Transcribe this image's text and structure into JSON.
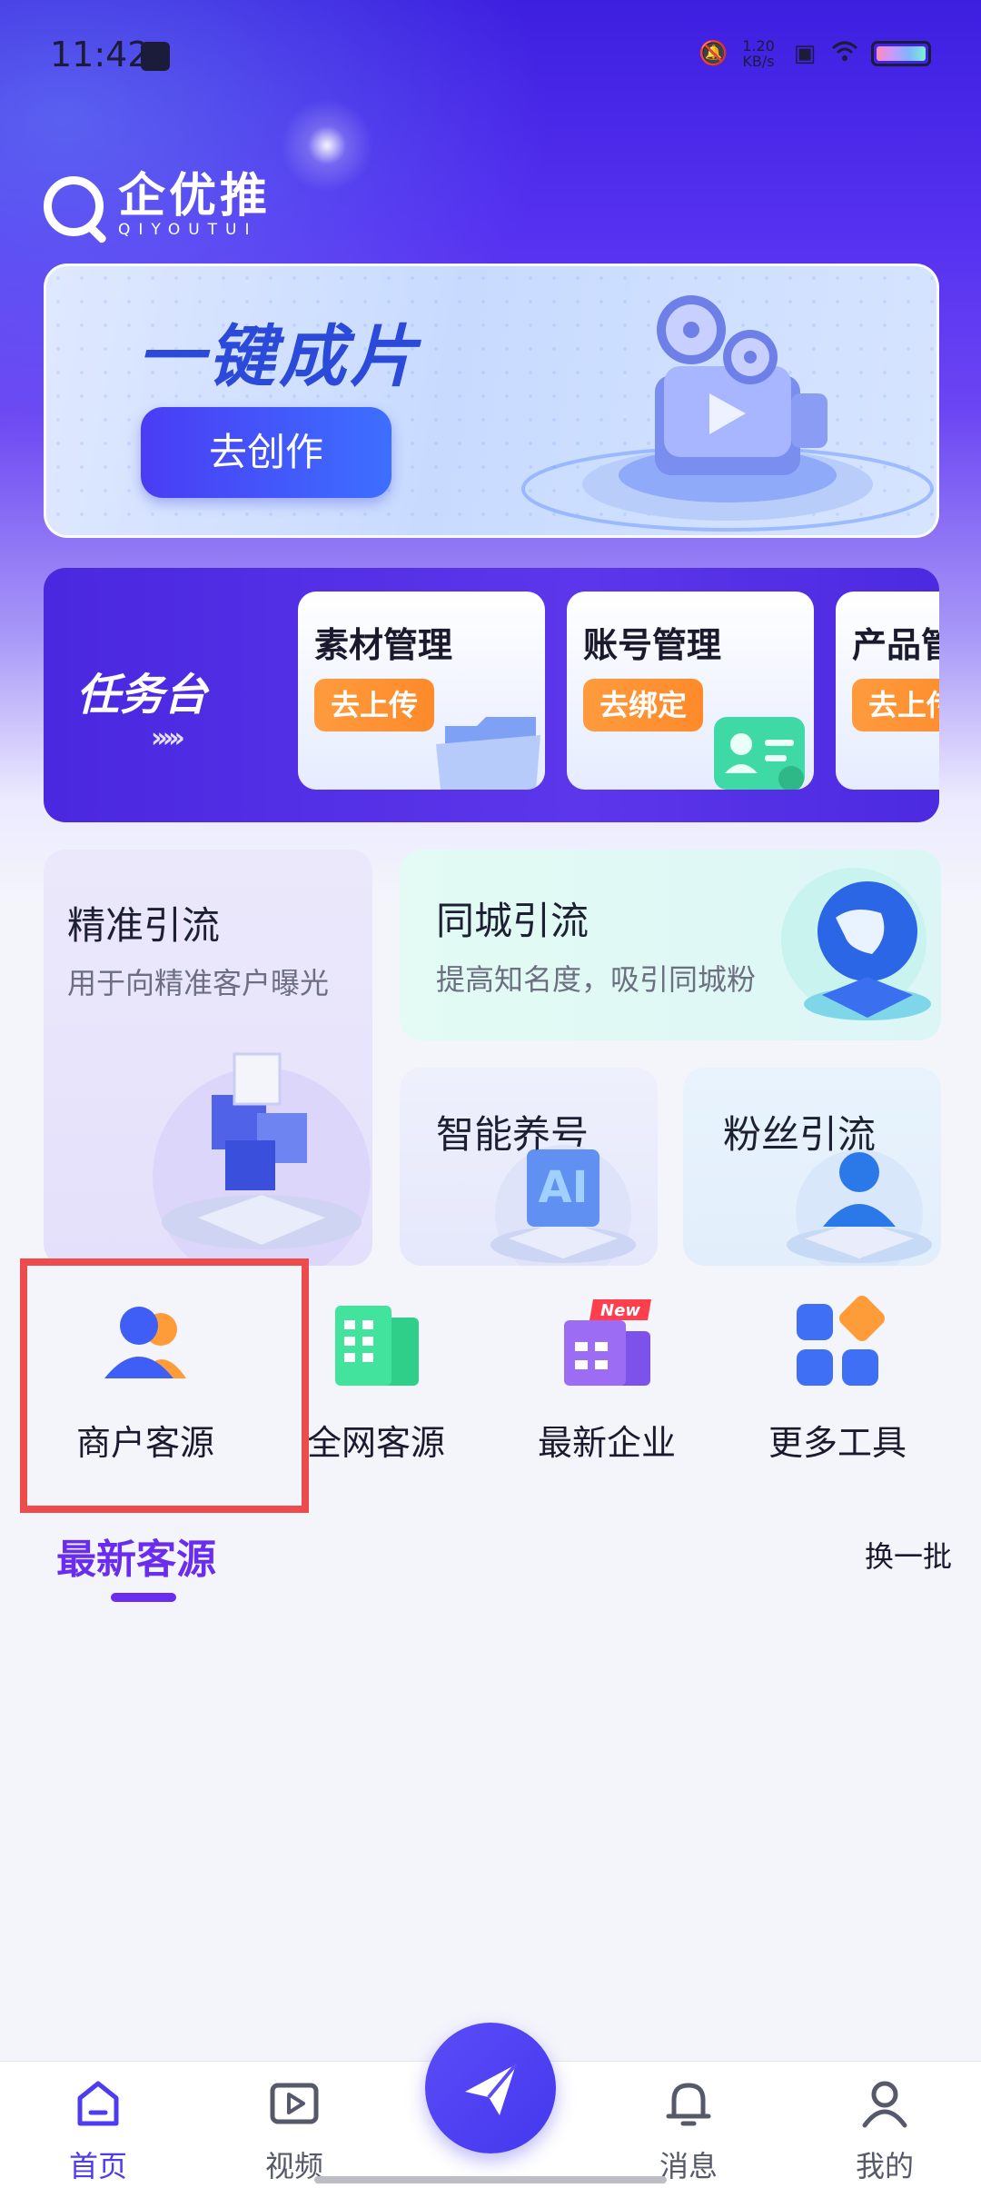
{
  "status_bar": {
    "time": "11:42",
    "net_speed_value": "1.20",
    "net_speed_unit": "KB/s"
  },
  "brand": {
    "name": "企优推",
    "subtitle": "QIYOUTUI"
  },
  "banner": {
    "title": "一键成片",
    "button_label": "去创作"
  },
  "task_panel": {
    "label": "任务台",
    "chevrons": "›››››",
    "cards": [
      {
        "title": "素材管理",
        "button": "去上传"
      },
      {
        "title": "账号管理",
        "button": "去绑定"
      },
      {
        "title": "产品管",
        "button": "去上传"
      }
    ]
  },
  "features": {
    "precise": {
      "title": "精准引流",
      "desc": "用于向精准客户曝光"
    },
    "local": {
      "title": "同城引流",
      "desc": "提高知名度，吸引同城粉"
    },
    "nurture": {
      "title": "智能养号",
      "art_text": "AI"
    },
    "fans": {
      "title": "粉丝引流"
    }
  },
  "tools": [
    {
      "label": "商户客源",
      "icon": "users-icon"
    },
    {
      "label": "全网客源",
      "icon": "buildings-icon"
    },
    {
      "label": "最新企业",
      "icon": "new-building-icon",
      "badge": "New"
    },
    {
      "label": "更多工具",
      "icon": "grid-icon"
    }
  ],
  "latest": {
    "title": "最新客源",
    "refresh": "换一批"
  },
  "bottom_nav": {
    "items": [
      {
        "label": "首页",
        "icon": "home-icon",
        "active": true
      },
      {
        "label": "视频",
        "icon": "video-icon"
      },
      {
        "label": "消息",
        "icon": "bell-icon"
      },
      {
        "label": "我的",
        "icon": "user-icon"
      }
    ],
    "center_icon": "send-icon"
  },
  "colors": {
    "accent": "#6a2df0",
    "primary_nav": "#4d3cf0",
    "orange": "#ff8a2a",
    "highlight": "#ee4c4c"
  }
}
